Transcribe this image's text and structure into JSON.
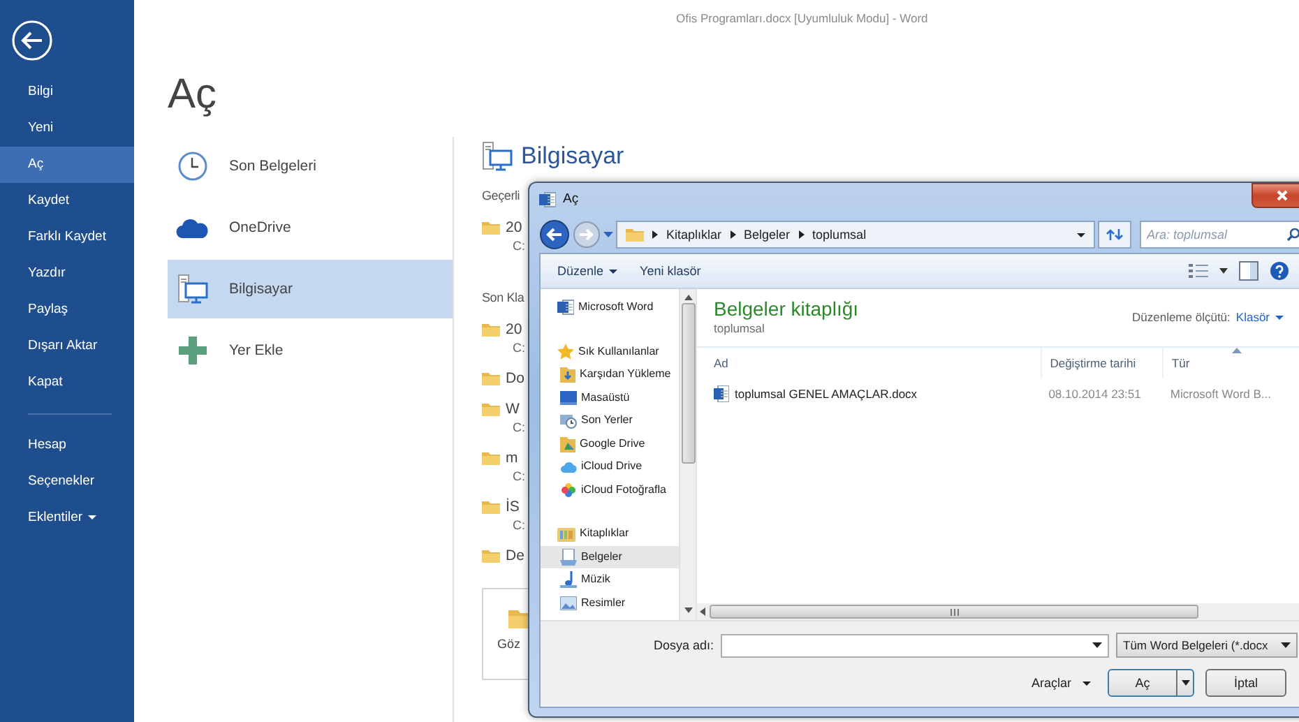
{
  "window": {
    "title": "Ofis Programları.docx [Uyumluluk Modu] - Word"
  },
  "nav": {
    "main_items": [
      {
        "label": "Bilgi",
        "selected": false
      },
      {
        "label": "Yeni",
        "selected": false
      },
      {
        "label": "Aç",
        "selected": true
      },
      {
        "label": "Kaydet",
        "selected": false
      },
      {
        "label": "Farklı Kaydet",
        "selected": false
      },
      {
        "label": "Yazdır",
        "selected": false
      },
      {
        "label": "Paylaş",
        "selected": false
      },
      {
        "label": "Dışarı Aktar",
        "selected": false
      },
      {
        "label": "Kapat",
        "selected": false
      }
    ],
    "account_items": [
      {
        "label": "Hesap",
        "selected": false,
        "has_menu": false
      },
      {
        "label": "Seçenekler",
        "selected": false,
        "has_menu": false
      },
      {
        "label": "Eklentiler",
        "selected": false,
        "has_menu": true
      }
    ]
  },
  "page": {
    "title": "Aç",
    "places": [
      {
        "label": "Son Belgeleri",
        "kind": "recent",
        "selected": false
      },
      {
        "label": "OneDrive",
        "kind": "cloud",
        "selected": false
      },
      {
        "label": "Bilgisayar",
        "kind": "computer",
        "selected": true
      },
      {
        "label": "Yer Ekle",
        "kind": "add",
        "selected": false
      }
    ]
  },
  "computer_panel": {
    "title": "Bilgisayar",
    "current_heading": "Geçerli",
    "current_folders": [
      {
        "name": "20",
        "path": "C:"
      }
    ],
    "recent_heading": "Son Kla",
    "recent_folders": [
      {
        "name": "20",
        "path": "C:"
      },
      {
        "name": "Do"
      },
      {
        "name": "W",
        "path": "C:"
      },
      {
        "name": "m",
        "path": "C:"
      },
      {
        "name": "İS",
        "path": "C:"
      },
      {
        "name": "De"
      }
    ],
    "browse_label": "Göz"
  },
  "dialog": {
    "title": "Aç",
    "breadcrumb": [
      "Kitaplıklar",
      "Belgeler",
      "toplumsal"
    ],
    "search": {
      "placeholder": "Ara: toplumsal"
    },
    "toolbar": [
      {
        "label": "Düzenle",
        "has_menu": true
      },
      {
        "label": "Yeni klasör",
        "has_menu": false
      }
    ],
    "nav_pane": [
      {
        "label": "Microsoft Word",
        "kind": "word",
        "selected": false
      },
      {
        "label": "Sık Kullanılanlar",
        "kind": "favorites",
        "selected": false,
        "children": [
          {
            "label": "Karşıdan Yükleme",
            "kind": "downloads",
            "selected": false
          },
          {
            "label": "Masaüstü",
            "kind": "desktop",
            "selected": false
          },
          {
            "label": "Son Yerler",
            "kind": "recent_places",
            "selected": false
          },
          {
            "label": "Google Drive",
            "kind": "gdrive",
            "selected": false
          },
          {
            "label": "iCloud Drive",
            "kind": "icloud",
            "selected": false
          },
          {
            "label": "iCloud Fotoğrafla",
            "kind": "photos",
            "selected": false
          }
        ]
      },
      {
        "label": "Kitaplıklar",
        "kind": "libraries",
        "selected": false,
        "children": [
          {
            "label": "Belgeler",
            "kind": "documents",
            "selected": true
          },
          {
            "label": "Müzik",
            "kind": "music",
            "selected": false
          },
          {
            "label": "Resimler",
            "kind": "pictures",
            "selected": false
          }
        ]
      }
    ],
    "content": {
      "title": "Belgeler kitaplığı",
      "subtitle": "toplumsal",
      "arrange_label": "Düzenleme ölçütü:",
      "arrange_value": "Klasör",
      "columns": [
        {
          "label": "Ad",
          "sorted": false
        },
        {
          "label": "Değiştirme tarihi",
          "sorted": false
        },
        {
          "label": "Tür",
          "sorted": true
        }
      ],
      "rows": [
        {
          "name": "toplumsal GENEL AMAÇLAR.docx",
          "modified": "08.10.2014 23:51",
          "type": "Microsoft Word B..."
        }
      ]
    },
    "footer": {
      "filename_label": "Dosya adı:",
      "filter": "Tüm Word Belgeleri (*.docx",
      "tools_label": "Araçlar",
      "open_label": "Aç",
      "cancel_label": "İptal"
    }
  }
}
